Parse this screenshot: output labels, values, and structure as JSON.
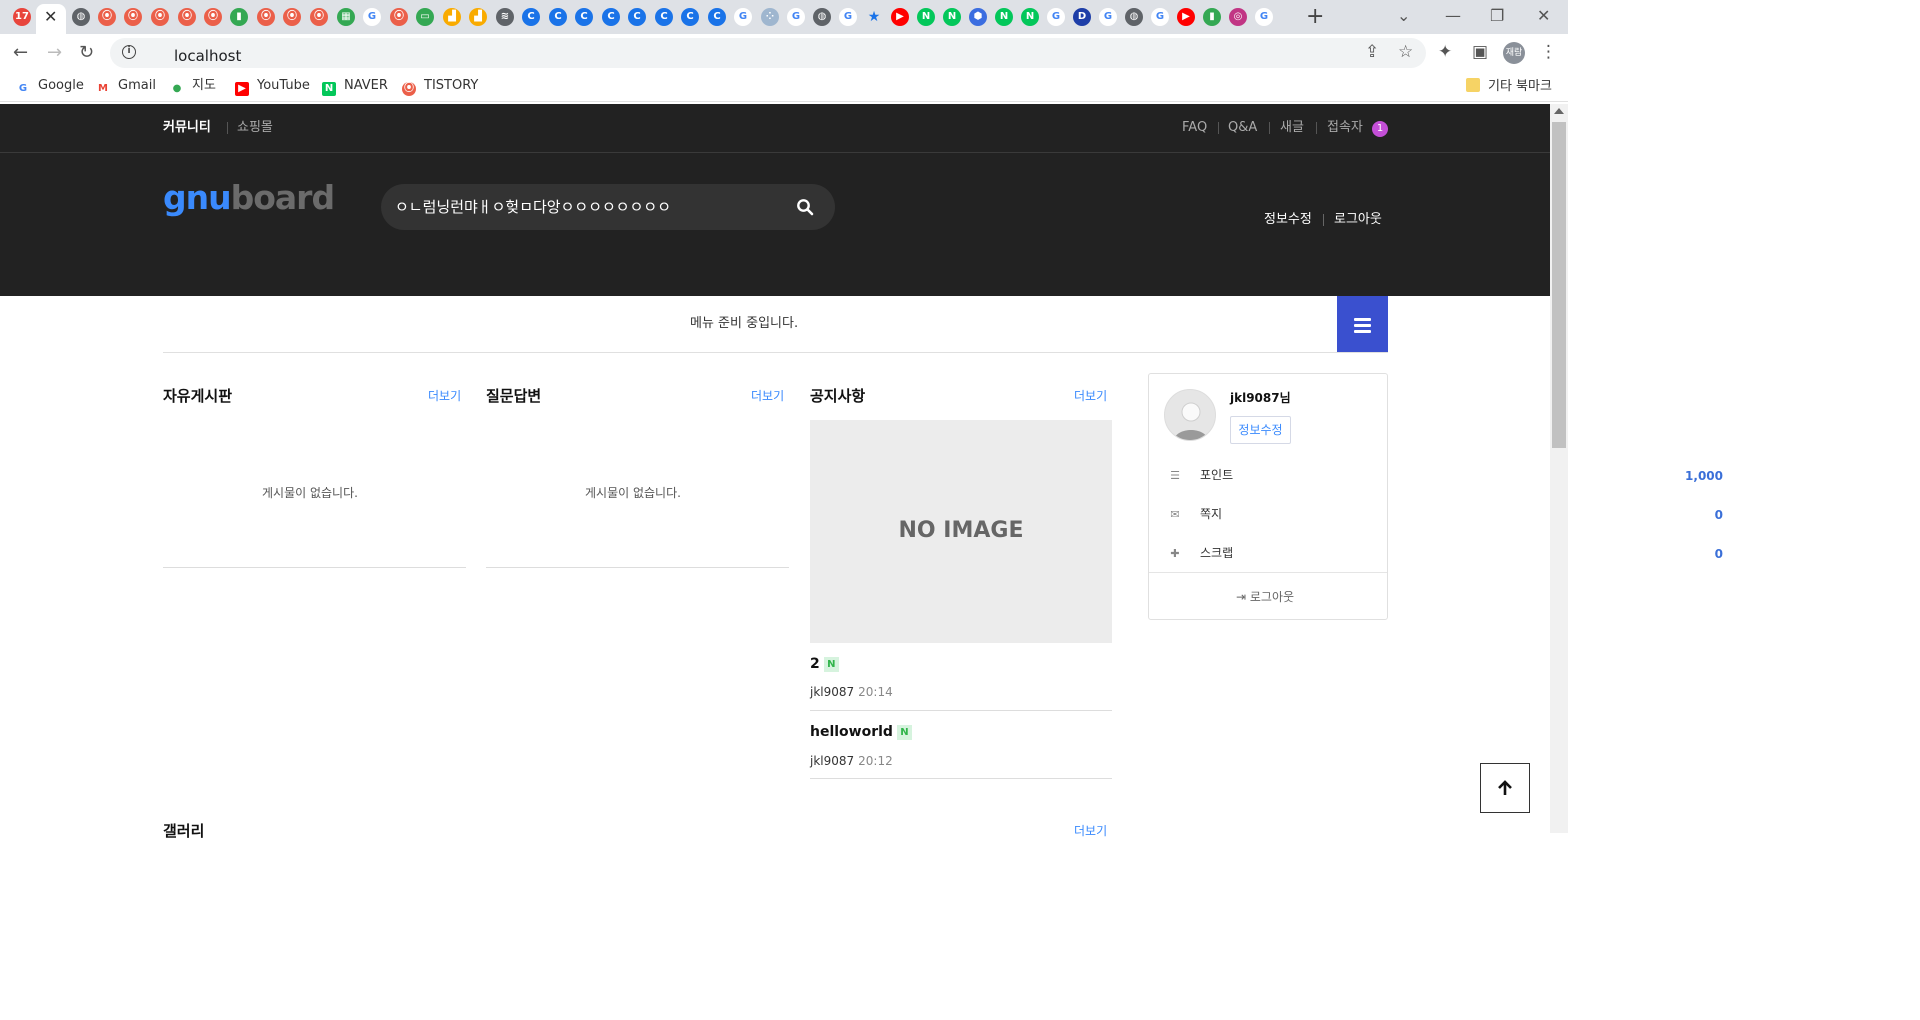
{
  "browser": {
    "url": "localhost",
    "tab_favicons": [
      {
        "icon": "calendar-icon",
        "color": "#e8453c",
        "glyph": "17"
      },
      {
        "icon": "globe-icon",
        "color": "#5f6368",
        "glyph": "◍"
      },
      {
        "icon": "tistory-icon",
        "color": "#eb5f49",
        "glyph": "⦿"
      },
      {
        "icon": "tistory-icon",
        "color": "#eb5f49",
        "glyph": "⦿"
      },
      {
        "icon": "tistory-icon",
        "color": "#eb5f49",
        "glyph": "⦿"
      },
      {
        "icon": "tistory-icon",
        "color": "#eb5f49",
        "glyph": "⦿"
      },
      {
        "icon": "tistory-icon",
        "color": "#eb5f49",
        "glyph": "⦿"
      },
      {
        "icon": "maps-icon",
        "color": "#34a853",
        "glyph": "▮"
      },
      {
        "icon": "tistory-icon",
        "color": "#eb5f49",
        "glyph": "⦿"
      },
      {
        "icon": "tistory-icon",
        "color": "#eb5f49",
        "glyph": "⦿"
      },
      {
        "icon": "tistory-icon",
        "color": "#eb5f49",
        "glyph": "⦿"
      },
      {
        "icon": "sheets-icon",
        "color": "#34a853",
        "glyph": "▦"
      },
      {
        "icon": "google-icon",
        "color": "#4285f4",
        "glyph": "G"
      },
      {
        "icon": "tistory-icon",
        "color": "#eb5f49",
        "glyph": "⦿"
      },
      {
        "icon": "monitor-icon",
        "color": "#34a853",
        "glyph": "▭"
      },
      {
        "icon": "analytics-icon",
        "color": "#f9ab00",
        "glyph": "▟"
      },
      {
        "icon": "analytics-icon",
        "color": "#f9ab00",
        "glyph": "▟"
      },
      {
        "icon": "wifi-icon",
        "color": "#5f6368",
        "glyph": "≋"
      },
      {
        "icon": "c-icon",
        "color": "#1a73e8",
        "glyph": "C"
      },
      {
        "icon": "c-icon",
        "color": "#1a73e8",
        "glyph": "C"
      },
      {
        "icon": "c-icon",
        "color": "#1a73e8",
        "glyph": "C"
      },
      {
        "icon": "c-icon",
        "color": "#1a73e8",
        "glyph": "C"
      },
      {
        "icon": "c-icon",
        "color": "#1a73e8",
        "glyph": "C"
      },
      {
        "icon": "c-icon",
        "color": "#1a73e8",
        "glyph": "C"
      },
      {
        "icon": "c-icon",
        "color": "#1a73e8",
        "glyph": "C"
      },
      {
        "icon": "c-icon",
        "color": "#1a73e8",
        "glyph": "C"
      },
      {
        "icon": "google-icon",
        "color": "#4285f4",
        "glyph": "G"
      },
      {
        "icon": "dots-icon",
        "color": "#9fb6cf",
        "glyph": "⁘"
      },
      {
        "icon": "google-icon",
        "color": "#4285f4",
        "glyph": "G"
      },
      {
        "icon": "globe-icon",
        "color": "#5f6368",
        "glyph": "◍"
      },
      {
        "icon": "google-icon",
        "color": "#4285f4",
        "glyph": "G"
      },
      {
        "icon": "star-icon",
        "color": "#1a73e8",
        "glyph": "★"
      },
      {
        "icon": "youtube-icon",
        "color": "#ff0000",
        "glyph": "▶"
      },
      {
        "icon": "naver-icon",
        "color": "#03c75a",
        "glyph": "N"
      },
      {
        "icon": "naver-icon",
        "color": "#03c75a",
        "glyph": "N"
      },
      {
        "icon": "hexagon-icon",
        "color": "#3b6de0",
        "glyph": "⬢"
      },
      {
        "icon": "naver-icon",
        "color": "#03c75a",
        "glyph": "N"
      },
      {
        "icon": "naver-icon",
        "color": "#03c75a",
        "glyph": "N"
      },
      {
        "icon": "google-icon",
        "color": "#4285f4",
        "glyph": "G"
      },
      {
        "icon": "d-icon",
        "color": "#1e3ea8",
        "glyph": "D"
      },
      {
        "icon": "google-icon",
        "color": "#4285f4",
        "glyph": "G"
      },
      {
        "icon": "globe-icon",
        "color": "#5f6368",
        "glyph": "◍"
      },
      {
        "icon": "google-icon",
        "color": "#4285f4",
        "glyph": "G"
      },
      {
        "icon": "youtube-icon",
        "color": "#ff0000",
        "glyph": "▶"
      },
      {
        "icon": "maps-icon",
        "color": "#34a853",
        "glyph": "▮"
      },
      {
        "icon": "instagram-icon",
        "color": "#c13584",
        "glyph": "◎"
      },
      {
        "icon": "google-icon",
        "color": "#4285f4",
        "glyph": "G"
      }
    ],
    "profile_label": "재람",
    "bookmarks": [
      {
        "label": "Google",
        "icon": "google-icon",
        "color": "#4285f4",
        "glyph": "G"
      },
      {
        "label": "Gmail",
        "icon": "gmail-icon",
        "color": "#ea4335",
        "glyph": "M"
      },
      {
        "label": "지도",
        "icon": "maps-pin-icon",
        "color": "#34a853",
        "glyph": "●"
      },
      {
        "label": "YouTube",
        "icon": "youtube-icon",
        "color": "#ff0000",
        "glyph": "▶"
      },
      {
        "label": "NAVER",
        "icon": "naver-icon",
        "color": "#03c75a",
        "glyph": "N"
      },
      {
        "label": "TISTORY",
        "icon": "tistory-icon",
        "color": "#eb5f49",
        "glyph": "⦿"
      }
    ],
    "other_bookmarks": "기타 북마크"
  },
  "topbar": {
    "community": "커뮤니티",
    "shop": "쇼핑몰",
    "faq": "FAQ",
    "qa": "Q&A",
    "new_posts": "새글",
    "visitors": "접속자",
    "visitor_count": "1"
  },
  "header": {
    "logo_gnu": "gnu",
    "logo_board": "board",
    "search_value": "ㅇㄴ럼닝런먀ㅐㅇ헞ㅁ다앙ㅇㅇㅇㅇㅇㅇㅇㅇ",
    "edit_profile": "정보수정",
    "logout": "로그아웃"
  },
  "menu": {
    "message": "메뉴 준비 중입니다."
  },
  "boards": {
    "more": "더보기",
    "free": {
      "title": "자유게시판",
      "empty": "게시물이 없습니다."
    },
    "qa": {
      "title": "질문답변",
      "empty": "게시물이 없습니다."
    },
    "notice": {
      "title": "공지사항",
      "no_image": "NO IMAGE",
      "posts": [
        {
          "title": "2",
          "badge": "N",
          "author": "jkl9087",
          "time": "20:14"
        },
        {
          "title": "helloworld",
          "badge": "N",
          "author": "jkl9087",
          "time": "20:12"
        }
      ]
    },
    "gallery": {
      "title": "갤러리"
    }
  },
  "profile_card": {
    "username": "jkl9087님",
    "edit_button": "정보수정",
    "stats": [
      {
        "label": "포인트",
        "value": "1,000",
        "icon": "database-icon"
      },
      {
        "label": "쪽지",
        "value": "0",
        "icon": "envelope-icon"
      },
      {
        "label": "스크랩",
        "value": "0",
        "icon": "pin-icon"
      }
    ],
    "logout": "로그아웃"
  },
  "colors": {
    "accent": "#3a8afd",
    "menu_button": "#3a50cf",
    "dark_bg": "#222222",
    "badge": "#c44fd7",
    "new_badge_bg": "#d6f3de"
  }
}
